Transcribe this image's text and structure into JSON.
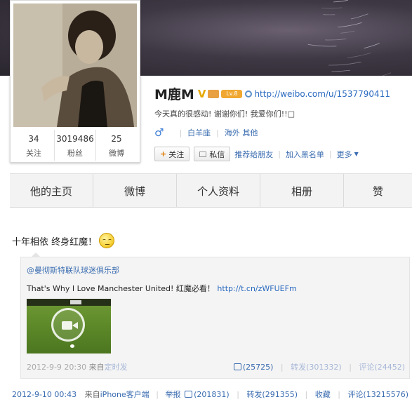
{
  "profile": {
    "name": "M鹿M",
    "verified_mark": "V",
    "level_badge": "Lv.8",
    "homepage_url": "http://weibo.com/u/1537790411",
    "bio": "今天真的很感动! 谢谢你们! 我爱你们!!□",
    "gender_symbol": "♂",
    "constellation": "白羊座",
    "location": "海外 其他",
    "stats": [
      {
        "value": "34",
        "label": "关注"
      },
      {
        "value": "3019486",
        "label": "粉丝"
      },
      {
        "value": "25",
        "label": "微博"
      }
    ],
    "actions": {
      "follow": "关注",
      "message": "私信",
      "recommend": "推荐给朋友",
      "blacklist": "加入黑名单",
      "more": "更多"
    }
  },
  "tabs": [
    "他的主页",
    "微博",
    "个人资料",
    "相册",
    "赞"
  ],
  "post": {
    "text": "十年相依 终身红魔！",
    "repost": {
      "author": "@曼彻斯特联队球迷俱乐部",
      "text": "That's Why I Love Manchester United! 红魔必看！",
      "url": "http://t.cn/zWFUEFm",
      "time": "2012-9-9 20:30",
      "from_label": "来自",
      "source": "定时发",
      "likes": "(25725)",
      "reposts": "转发(301332)",
      "comments": "评论(24452)"
    },
    "time": "2012-9-10 00:43",
    "from_label": "来自",
    "source": "iPhone客户端",
    "report": "举报",
    "likes": "(201831)",
    "reposts": "转发(291355)",
    "favorite": "收藏",
    "comments": "评论(13215576)"
  },
  "colors": {
    "link": "#3a6cb0",
    "accent": "#e07b00",
    "tab_bg": "#f3f3f3"
  }
}
